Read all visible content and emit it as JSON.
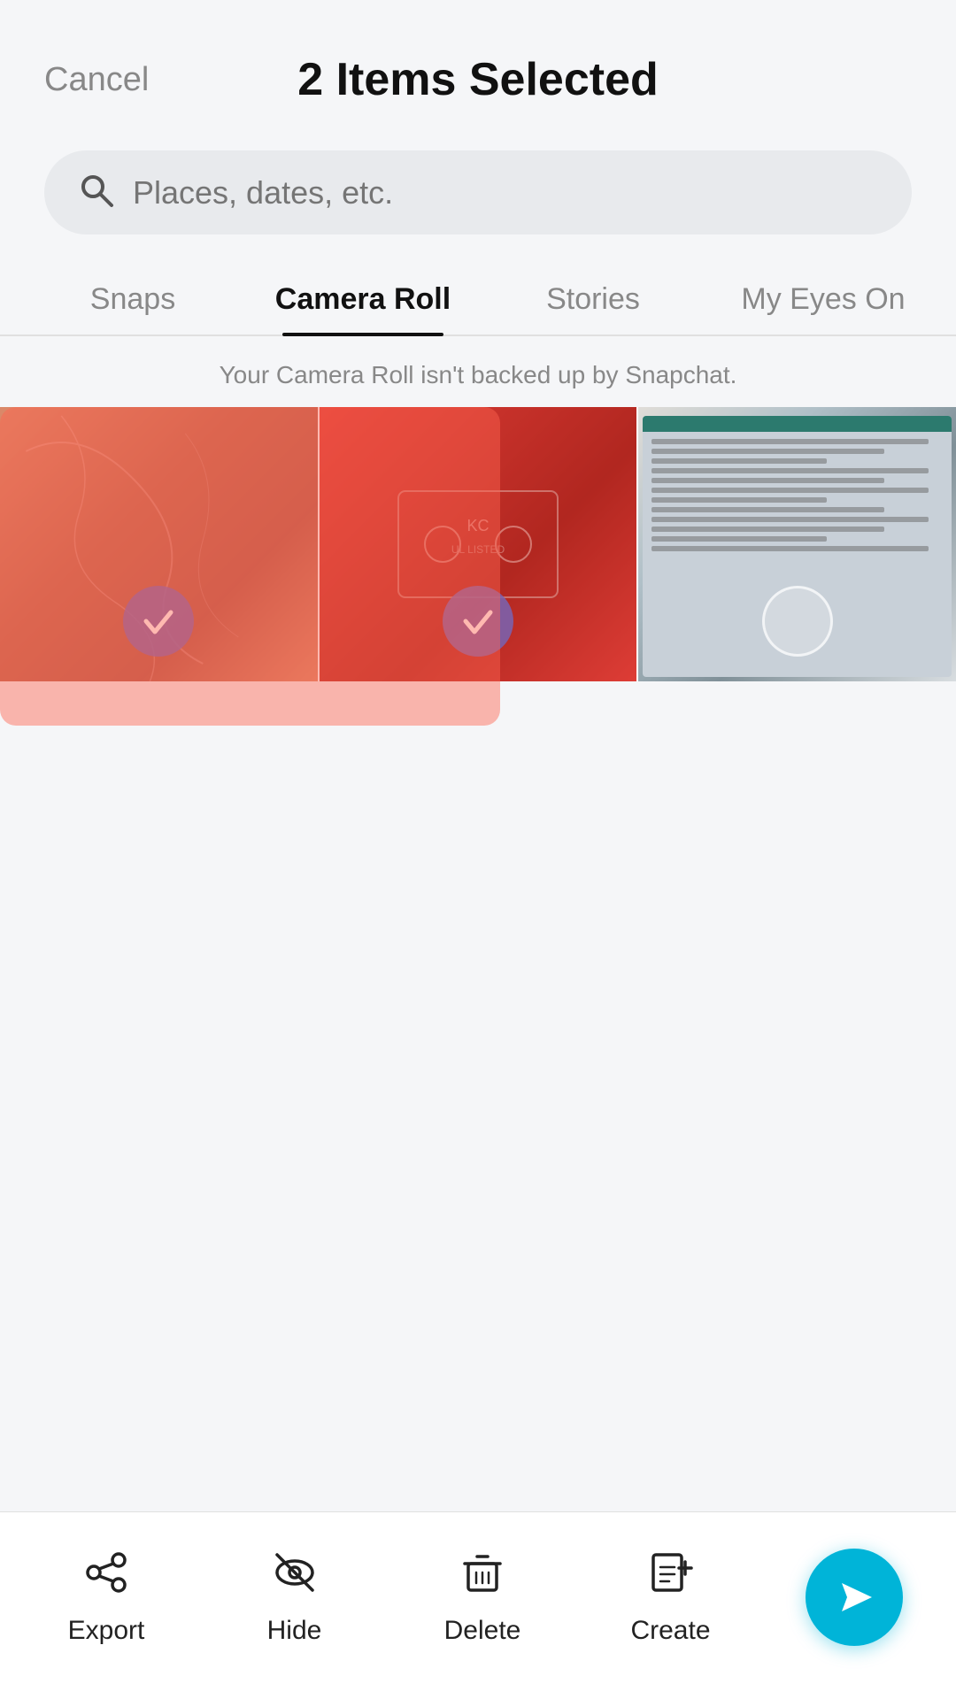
{
  "header": {
    "cancel_label": "Cancel",
    "title": "2 Items Selected"
  },
  "search": {
    "placeholder": "Places, dates, etc."
  },
  "tabs": [
    {
      "id": "snaps",
      "label": "Snaps",
      "active": false
    },
    {
      "id": "camera-roll",
      "label": "Camera Roll",
      "active": true
    },
    {
      "id": "stories",
      "label": "Stories",
      "active": false
    },
    {
      "id": "my-eyes-on",
      "label": "My Eyes On",
      "active": false
    }
  ],
  "notice": "Your Camera Roll isn't backed up by Snapchat.",
  "photos": [
    {
      "id": 1,
      "selected": true,
      "type": "texture"
    },
    {
      "id": 2,
      "selected": true,
      "type": "red"
    },
    {
      "id": 3,
      "selected": false,
      "type": "screen"
    }
  ],
  "toolbar": {
    "export_label": "Export",
    "hide_label": "Hide",
    "delete_label": "Delete",
    "create_label": "Create"
  },
  "colors": {
    "accent_blue": "#00b4d8",
    "selected_red": "rgba(255,100,80,0.45)",
    "check_purple": "rgba(120,100,180,0.85)"
  }
}
